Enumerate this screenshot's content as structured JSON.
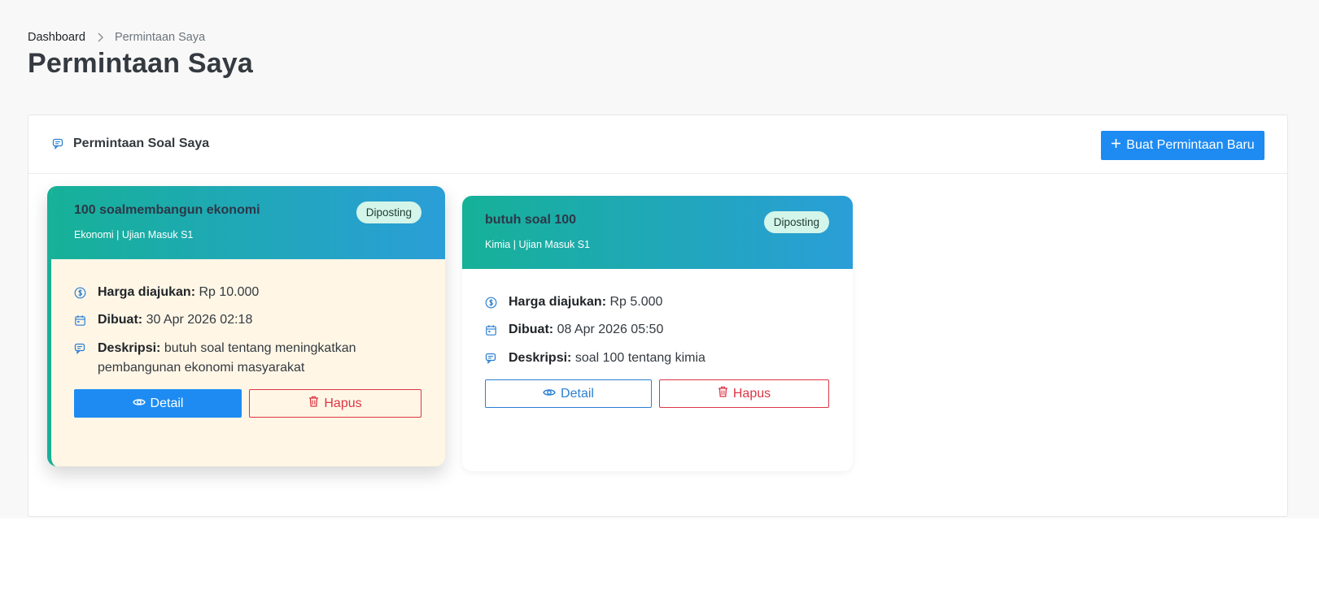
{
  "breadcrumb": {
    "home": "Dashboard",
    "current": "Permintaan Saya"
  },
  "page_title": "Permintaan Saya",
  "panel": {
    "title": "Permintaan Soal Saya",
    "new_button": "Buat Permintaan Baru"
  },
  "cards": [
    {
      "title": "100 soalmembangun ekonomi",
      "subtitle": "Ekonomi | Ujian Masuk S1",
      "status": "Diposting",
      "price_label": "Harga diajukan:",
      "price_value": "Rp 10.000",
      "created_label": "Dibuat:",
      "created_value": "30 Apr 2026 02:18",
      "desc_label": "Deskripsi:",
      "desc_value": "butuh soal tentang meningkatkan pembangunan ekonomi masyarakat",
      "detail_label": "Detail",
      "delete_label": "Hapus"
    },
    {
      "title": "butuh soal 100",
      "subtitle": "Kimia | Ujian Masuk S1",
      "status": "Diposting",
      "price_label": "Harga diajukan:",
      "price_value": "Rp 5.000",
      "created_label": "Dibuat:",
      "created_value": "08 Apr 2026 05:50",
      "desc_label": "Deskripsi:",
      "desc_value": "soal 100 tentang kimia",
      "detail_label": "Detail",
      "delete_label": "Hapus"
    }
  ],
  "icons": {
    "crumb_separator": "chevron-right-icon",
    "panel": "chat-icon",
    "new": "plus-icon",
    "price": "dollar-circle-icon",
    "created": "calendar-icon",
    "desc": "chat-icon",
    "detail": "eye-icon",
    "delete": "trash-icon"
  },
  "colors": {
    "primary": "#1d8bf2",
    "danger": "#dc3545",
    "header_gradient_start": "#16b198",
    "header_gradient_end": "#2a9ed8",
    "badge_bg": "#d4f5e9",
    "highlight_bg": "#fff6e6"
  }
}
